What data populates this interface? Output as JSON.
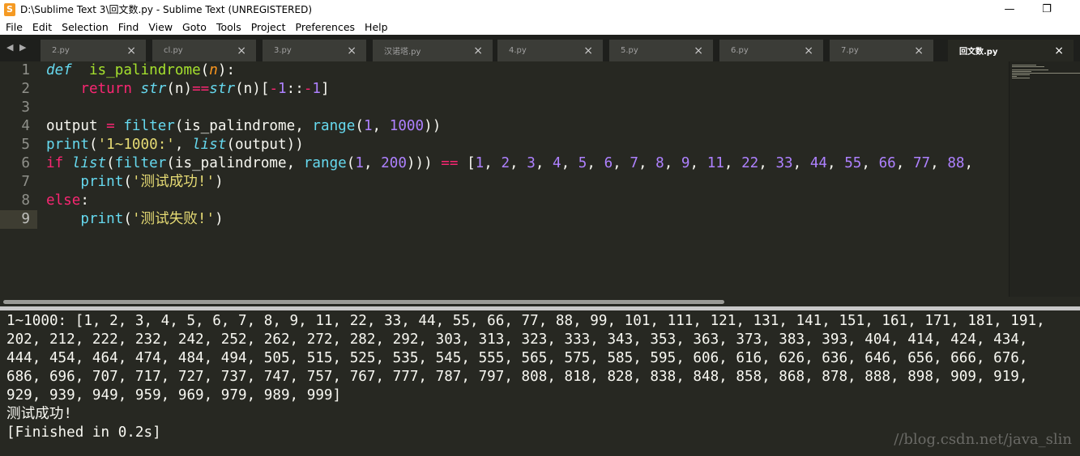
{
  "window": {
    "title": "D:\\Sublime Text 3\\回文数.py - Sublime Text (UNREGISTERED)",
    "app_icon": "S",
    "minimize": "—",
    "maximize": "❐"
  },
  "menu": [
    "File",
    "Edit",
    "Selection",
    "Find",
    "View",
    "Goto",
    "Tools",
    "Project",
    "Preferences",
    "Help"
  ],
  "nav_arrows": "◀ ▶",
  "tabs": [
    {
      "label": "2.py",
      "active": false
    },
    {
      "label": "cl.py",
      "active": false
    },
    {
      "label": "3.py",
      "active": false
    },
    {
      "label": "汉诺塔.py",
      "active": false
    },
    {
      "label": "4.py",
      "active": false
    },
    {
      "label": "5.py",
      "active": false
    },
    {
      "label": "6.py",
      "active": false
    },
    {
      "label": "7.py",
      "active": false
    },
    {
      "label": "回文数.py",
      "active": true
    }
  ],
  "tab_close": "×",
  "line_numbers": [
    "1",
    "2",
    "3",
    "4",
    "5",
    "6",
    "7",
    "8",
    "9"
  ],
  "current_line": 9,
  "code": [
    [
      [
        "kw",
        "def"
      ],
      [
        "",
        "  "
      ],
      [
        "fn",
        "is_palindrome"
      ],
      [
        "",
        "("
      ],
      [
        "param",
        "n"
      ],
      [
        "",
        "):"
      ]
    ],
    [
      [
        "",
        "    "
      ],
      [
        "kwr",
        "return"
      ],
      [
        "",
        " "
      ],
      [
        "bi-i",
        "str"
      ],
      [
        "",
        "(n)"
      ],
      [
        "op",
        "=="
      ],
      [
        "bi-i",
        "str"
      ],
      [
        "",
        "(n)["
      ],
      [
        "op",
        "-"
      ],
      [
        "num",
        "1"
      ],
      [
        "",
        "::"
      ],
      [
        "op",
        "-"
      ],
      [
        "num",
        "1"
      ],
      [
        "",
        "]"
      ]
    ],
    [],
    [
      [
        "",
        "output "
      ],
      [
        "op",
        "="
      ],
      [
        "",
        " "
      ],
      [
        "bi",
        "filter"
      ],
      [
        "",
        "(is_palindrome, "
      ],
      [
        "bi",
        "range"
      ],
      [
        "",
        "("
      ],
      [
        "num",
        "1"
      ],
      [
        "",
        ", "
      ],
      [
        "num",
        "1000"
      ],
      [
        "",
        "))"
      ]
    ],
    [
      [
        "bi",
        "print"
      ],
      [
        "",
        "("
      ],
      [
        "str",
        "'1~1000:'"
      ],
      [
        "",
        ", "
      ],
      [
        "bi-i",
        "list"
      ],
      [
        "",
        "(output))"
      ]
    ],
    [
      [
        "kwr",
        "if"
      ],
      [
        "",
        " "
      ],
      [
        "bi-i",
        "list"
      ],
      [
        "",
        "("
      ],
      [
        "bi",
        "filter"
      ],
      [
        "",
        "(is_palindrome, "
      ],
      [
        "bi",
        "range"
      ],
      [
        "",
        "("
      ],
      [
        "num",
        "1"
      ],
      [
        "",
        ", "
      ],
      [
        "num",
        "200"
      ],
      [
        "",
        ")))"
      ],
      [
        "",
        " "
      ],
      [
        "op",
        "=="
      ],
      [
        "",
        " ["
      ],
      [
        "num",
        "1"
      ],
      [
        "",
        ", "
      ],
      [
        "num",
        "2"
      ],
      [
        "",
        ", "
      ],
      [
        "num",
        "3"
      ],
      [
        "",
        ", "
      ],
      [
        "num",
        "4"
      ],
      [
        "",
        ", "
      ],
      [
        "num",
        "5"
      ],
      [
        "",
        ", "
      ],
      [
        "num",
        "6"
      ],
      [
        "",
        ", "
      ],
      [
        "num",
        "7"
      ],
      [
        "",
        ", "
      ],
      [
        "num",
        "8"
      ],
      [
        "",
        ", "
      ],
      [
        "num",
        "9"
      ],
      [
        "",
        ", "
      ],
      [
        "num",
        "11"
      ],
      [
        "",
        ", "
      ],
      [
        "num",
        "22"
      ],
      [
        "",
        ", "
      ],
      [
        "num",
        "33"
      ],
      [
        "",
        ", "
      ],
      [
        "num",
        "44"
      ],
      [
        "",
        ", "
      ],
      [
        "num",
        "55"
      ],
      [
        "",
        ", "
      ],
      [
        "num",
        "66"
      ],
      [
        "",
        ", "
      ],
      [
        "num",
        "77"
      ],
      [
        "",
        ", "
      ],
      [
        "num",
        "88"
      ],
      [
        "",
        ","
      ]
    ],
    [
      [
        "",
        "    "
      ],
      [
        "bi",
        "print"
      ],
      [
        "",
        "("
      ],
      [
        "str",
        "'测试成功!'"
      ],
      [
        "",
        ")"
      ]
    ],
    [
      [
        "kwr",
        "else"
      ],
      [
        "",
        ":"
      ]
    ],
    [
      [
        "",
        "    "
      ],
      [
        "bi",
        "print"
      ],
      [
        "",
        "("
      ],
      [
        "str",
        "'测试失败!'"
      ],
      [
        "",
        ")"
      ]
    ]
  ],
  "output_lines": [
    "1~1000: [1, 2, 3, 4, 5, 6, 7, 8, 9, 11, 22, 33, 44, 55, 66, 77, 88, 99, 101, 111, 121, 131, 141, 151, 161, 171, 181, 191,",
    "202, 212, 222, 232, 242, 252, 262, 272, 282, 292, 303, 313, 323, 333, 343, 353, 363, 373, 383, 393, 404, 414, 424, 434,",
    "444, 454, 464, 474, 484, 494, 505, 515, 525, 535, 545, 555, 565, 575, 585, 595, 606, 616, 626, 636, 646, 656, 666, 676,",
    "686, 696, 707, 717, 727, 737, 747, 757, 767, 777, 787, 797, 808, 818, 828, 838, 848, 858, 868, 878, 888, 898, 909, 919,",
    "929, 939, 949, 959, 969, 979, 989, 999]",
    "测试成功!",
    "[Finished in 0.2s]"
  ],
  "watermark": "//blog.csdn.net/java_slin",
  "colors": {
    "background": "#272822",
    "keyword": "#66d9ef",
    "function": "#a6e22e",
    "operator": "#f92672",
    "number": "#ae81ff",
    "string": "#e6db74",
    "parameter": "#fd971f"
  }
}
